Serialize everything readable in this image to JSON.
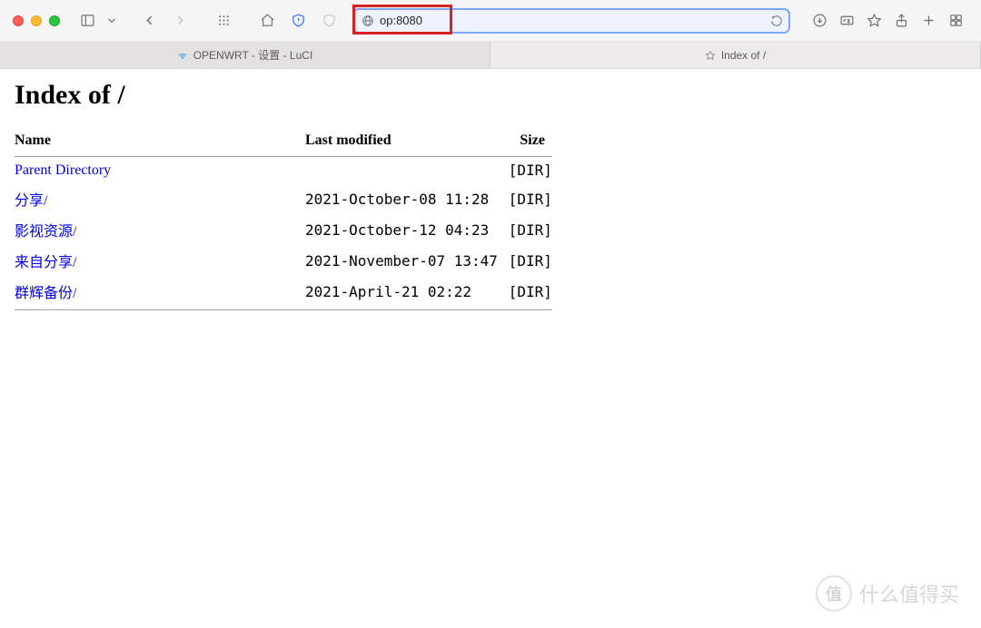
{
  "browser": {
    "url": "op:8080",
    "tabs": [
      {
        "title": "OPENWRT - 设置 - LuCI",
        "favicon": "wifi"
      },
      {
        "title": "Index of /",
        "favicon": "star"
      }
    ]
  },
  "page": {
    "heading": "Index of /",
    "columns": {
      "name": "Name",
      "mtime": "Last modified",
      "size": "Size"
    },
    "rows": [
      {
        "name": "Parent Directory",
        "mtime": "",
        "size": "[DIR]"
      },
      {
        "name": "分享/",
        "mtime": "2021-October-08 11:28",
        "size": "[DIR]"
      },
      {
        "name": "影视资源/",
        "mtime": "2021-October-12 04:23",
        "size": "[DIR]"
      },
      {
        "name": "来自分享/",
        "mtime": "2021-November-07 13:47",
        "size": "[DIR]"
      },
      {
        "name": "群辉备份/",
        "mtime": "2021-April-21 02:22",
        "size": "[DIR]"
      }
    ]
  },
  "watermark": {
    "badge": "值",
    "text": "什么值得买"
  }
}
